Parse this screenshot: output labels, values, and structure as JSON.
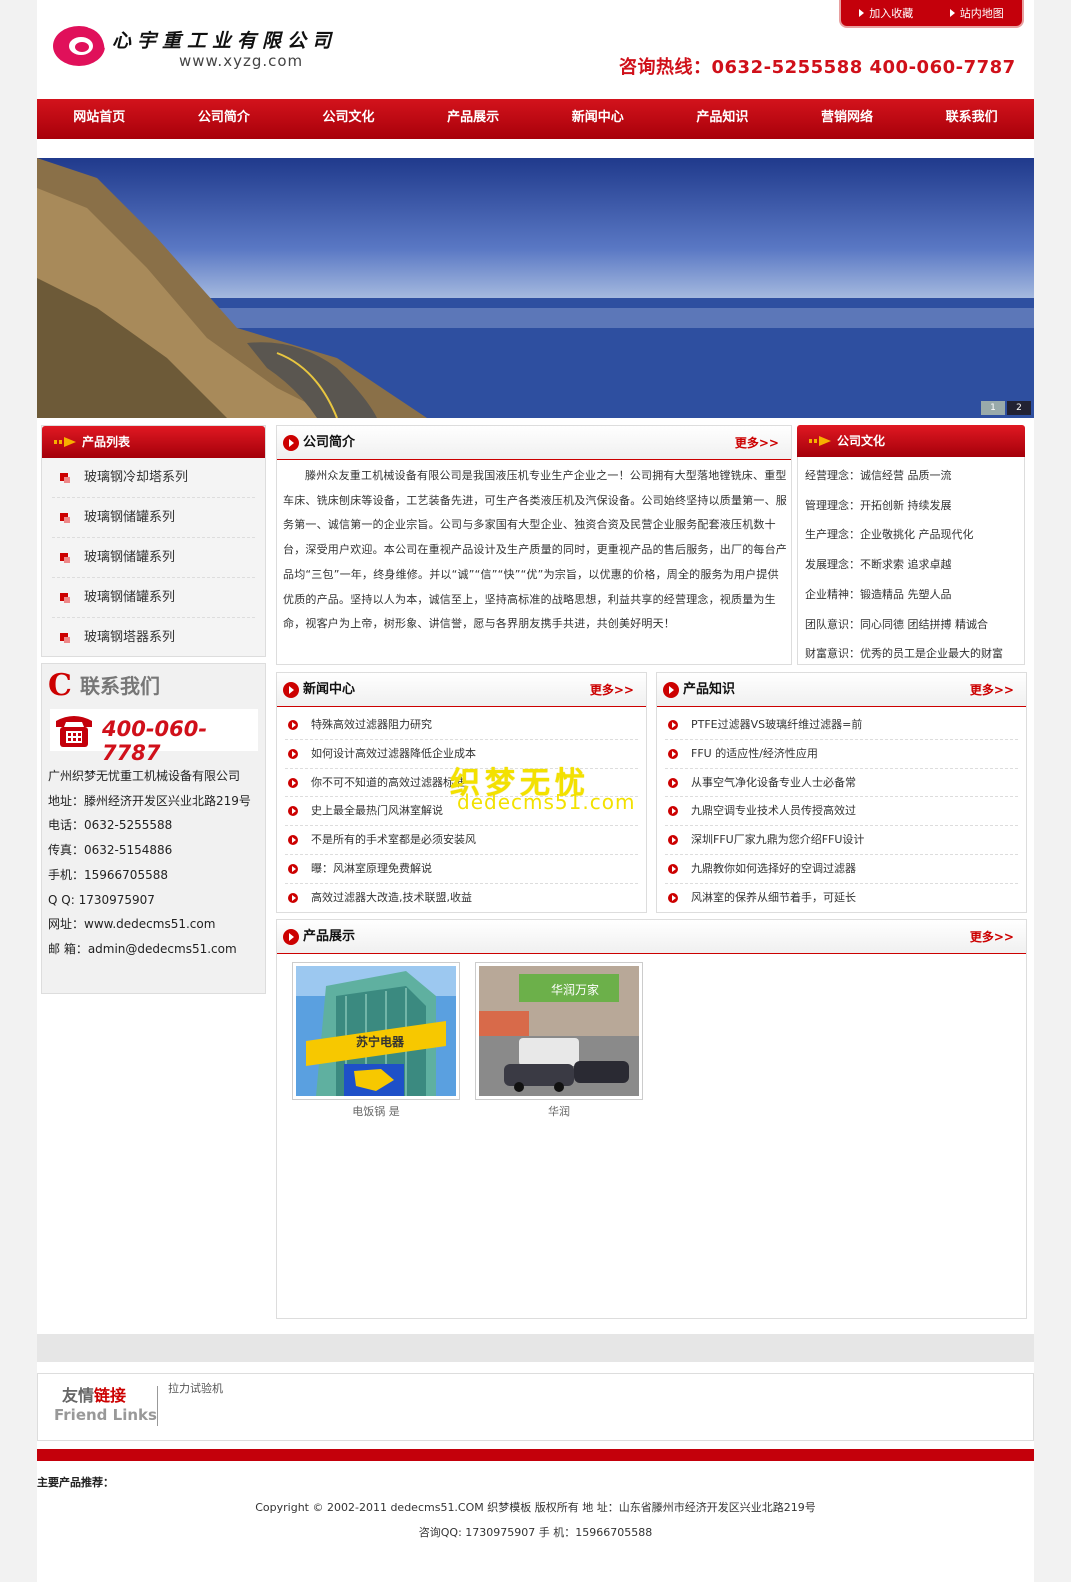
{
  "header": {
    "logo_text": "心宇重工业有限公司",
    "logo_url": "www.xyzg.com",
    "top_links": [
      "加入收藏",
      "站内地图"
    ],
    "hotline": "咨询热线：0632-5255588  400-060-7787"
  },
  "nav": [
    "网站首页",
    "公司简介",
    "公司文化",
    "产品展示",
    "新闻中心",
    "产品知识",
    "营销网络",
    "联系我们"
  ],
  "banner": {
    "slides": [
      "1",
      "2"
    ]
  },
  "product_list": {
    "title": "产品列表",
    "items": [
      "玻璃钢冷却塔系列",
      "玻璃钢储罐系列",
      "玻璃钢储罐系列",
      "玻璃钢储罐系列",
      "玻璃钢塔器系列"
    ]
  },
  "contact": {
    "title": "联系我们",
    "phone": "400-060-7787",
    "lines": [
      "广州织梦无忧重工机械设备有限公司",
      "地址：滕州经济开发区兴业北路219号",
      "电话：0632-5255588",
      "传真：0632-5154886",
      "手机：15966705588",
      "Q Q: 1730975907",
      "网址：www.dedecms51.com",
      "邮 箱：admin@dedecms51.com"
    ]
  },
  "about": {
    "title": "公司简介",
    "more": "更多>>",
    "text": "滕州众友重工机械设备有限公司是我国液压机专业生产企业之一！公司拥有大型落地镗铣床、重型车床、铣床刨床等设备，工艺装备先进，可生产各类液压机及汽保设备。公司始终坚持以质量第一、服务第一、诚信第一的企业宗旨。公司与多家国有大型企业、独资合资及民营企业服务配套液压机数十台，深受用户欢迎。本公司在重视产品设计及生产质量的同时，更重视产品的售后服务，出厂的每台产品均“三包”一年，终身维修。并以“诚”“信”“快”“优”为宗旨，以优惠的价格，周全的服务为用户提供优质的产品。坚持以人为本，诚信至上，坚持高标准的战略思想，利益共享的经营理念，视质量为生命，视客户为上帝，树形象、讲信誉，愿与各界朋友携手共进，共创美好明天！"
  },
  "culture": {
    "title": "公司文化",
    "items": [
      "经营理念：诚信经营 品质一流",
      "管理理念：开拓创新 持续发展",
      "生产理念：企业敬挑化 产品现代化",
      "发展理念：不断求索 追求卓越",
      "企业精神：锻造精品 先塑人品",
      "团队意识：同心同德 团结拼搏 精诚合",
      "财富意识：优秀的员工是企业最大的财富"
    ]
  },
  "news": {
    "title": "新闻中心",
    "more": "更多>>",
    "items": [
      "特殊高效过滤器阻力研究",
      "如何设计高效过滤器降低企业成本",
      "你不可不知道的高效过滤器标准",
      "史上最全最热门风淋室解说",
      "不是所有的手术室都是必须安装风",
      "曝：风淋室原理免费解说",
      "高效过滤器大改造,技术联盟,收益"
    ]
  },
  "knowledge": {
    "title": "产品知识",
    "more": "更多>>",
    "items": [
      "PTFE过滤器VS玻璃纤维过滤器=前",
      "FFU 的适应性/经济性应用",
      "从事空气净化设备专业人士必备常",
      "九鼎空调专业技术人员传授高效过",
      "深圳FFU厂家九鼎为您介绍FFU设计",
      "九鼎教你如何选择好的空调过滤器",
      "风淋室的保养从细节着手，可延长"
    ]
  },
  "products": {
    "title": "产品展示",
    "more": "更多>>",
    "items": [
      {
        "caption": "电饭锅 是",
        "sign_text": "苏宁电器"
      },
      {
        "caption": "华润",
        "sign_text": "华润万家"
      }
    ]
  },
  "watermark": {
    "cn": "织梦无忧",
    "url": "dedecms51.com"
  },
  "footer": {
    "links_cn_a": "友情",
    "links_cn_b": "链接",
    "links_en": "Friend Links",
    "link_item": "拉力试验机",
    "product_recommend": "主要产品推荐：",
    "copyright": "Copyright © 2002-2011 dedecms51.COM 织梦模板 版权所有 地 址：山东省滕州市经济开发区兴业北路219号",
    "contact": "咨询QQ: 1730975907 手 机：15966705588"
  },
  "colors": {
    "brand_red": "#c4000b",
    "banner_blue": "#2a4a9c"
  }
}
